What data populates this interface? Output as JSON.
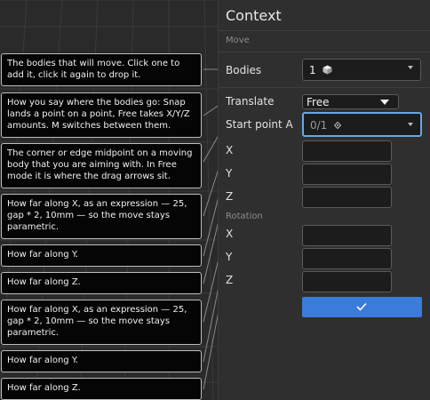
{
  "tooltips": [
    {
      "text": "The bodies that will move. Click one to add it, click it again to drop it."
    },
    {
      "text": "How you say where the bodies go: Snap lands a point on a point, Free takes X/Y/Z amounts. M switches between them."
    },
    {
      "text": "The corner or edge midpoint on a moving body that you are aiming with. In Free mode it is where the drag arrows sit."
    },
    {
      "text": "How far along X, as an expression — 25, gap * 2, 10mm — so the move stays parametric."
    },
    {
      "text": "How far along Y."
    },
    {
      "text": "How far along Z."
    },
    {
      "text": "How far along X, as an expression — 25, gap * 2, 10mm — so the move stays parametric."
    },
    {
      "text": "How far along Y."
    },
    {
      "text": "How far along Z."
    }
  ],
  "panel": {
    "title": "Context",
    "section_move": "Move",
    "bodies": {
      "label": "Bodies",
      "value": "1"
    },
    "translate": {
      "label": "Translate",
      "value": "Free"
    },
    "start_point": {
      "label": "Start point A",
      "value": "0/1"
    },
    "x": {
      "label": "X",
      "value": ""
    },
    "y": {
      "label": "Y",
      "value": ""
    },
    "z": {
      "label": "Z",
      "value": ""
    },
    "section_rotation": "Rotation",
    "rx": {
      "label": "X",
      "value": ""
    },
    "ry": {
      "label": "Y",
      "value": ""
    },
    "rz": {
      "label": "Z",
      "value": ""
    }
  },
  "colors": {
    "accent": "#3b7bdc",
    "focus_border": "#6aa6e6"
  }
}
